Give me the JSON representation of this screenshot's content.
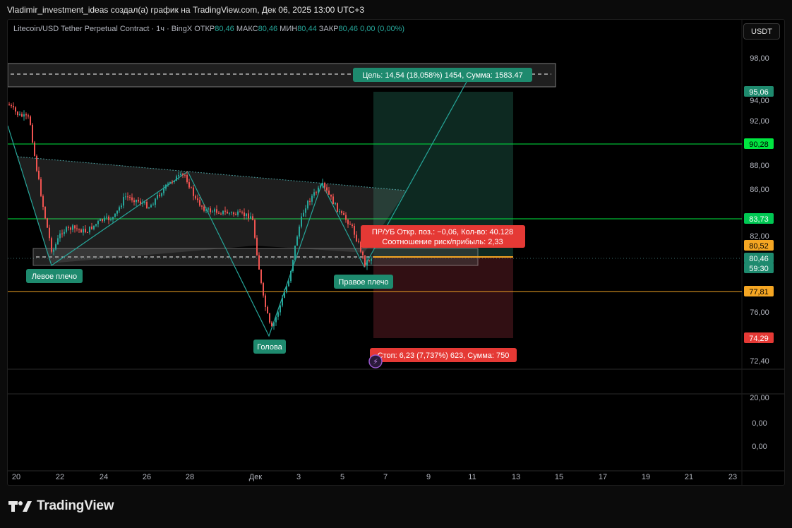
{
  "caption": "Vladimir_investment_ideas создал(а) график на TradingView.com, Дек 06, 2025 13:00 UTC+3",
  "legend": {
    "symbol": "Litecoin/USD Tether Perpetual Contract · 1ч · BingX",
    "open_label": "ОТКР",
    "open": "80,46",
    "high_label": "МАКС",
    "high": "80,46",
    "low_label": "МИН",
    "low": "80,44",
    "close_label": "ЗАКР",
    "close": "80,46",
    "change": "0,00 (0,00%)"
  },
  "currency_button": "USDT",
  "price_axis": {
    "ticks": [
      "98,00",
      "94,00",
      "92,00",
      "88,00",
      "86,00",
      "82,00",
      "76,00",
      "72,40"
    ],
    "labels": [
      {
        "text": "95,06",
        "color": "#1e8a6e"
      },
      {
        "text": "90,28",
        "color": "#00e640"
      },
      {
        "text": "83,73",
        "color": "#00c853"
      },
      {
        "text": "80,52",
        "color": "#f5a623"
      },
      {
        "text": "80,46",
        "color": "#1e8a6e"
      },
      {
        "text": "59:30",
        "color": "#1e8a6e"
      },
      {
        "text": "77,81",
        "color": "#f5a623"
      },
      {
        "text": "74,29",
        "color": "#e53935"
      }
    ],
    "indicator_ticks": [
      "20,00",
      "0,00",
      "0,00"
    ]
  },
  "time_axis": [
    "20",
    "22",
    "24",
    "26",
    "28",
    "Дек",
    "3",
    "5",
    "7",
    "9",
    "11",
    "13",
    "15",
    "17",
    "19",
    "21",
    "23"
  ],
  "annotations": {
    "left_shoulder": "Левое плечо",
    "head": "Голова",
    "right_shoulder": "Правое плечо",
    "target": "Цель: 14,54 (18,058%) 1454, Сумма: 1583.47",
    "stop": "Стоп: 6,23 (7,737%) 623, Сумма: 750",
    "pnl_line1": "ПР/УБ Откр. поз.: −0,06, Кол-во: 40.128",
    "pnl_line2": "Соотношение риск/прибыль: 2,33"
  },
  "horizontal_levels": {
    "target_line": 95.06,
    "resistance_1": 90.28,
    "resistance_2": 83.73,
    "entry": 80.52,
    "support": 77.81,
    "stop": 74.29
  },
  "brand": "TradingView",
  "colors": {
    "up": "#26a69a",
    "down": "#ef5350",
    "green_line": "#00e640",
    "orange_line": "#f5a623",
    "red": "#e53935",
    "teal": "#1e8a6e"
  }
}
